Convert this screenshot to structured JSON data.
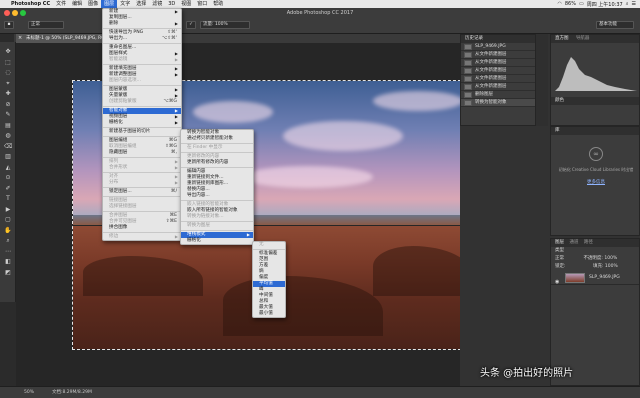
{
  "menubar": {
    "apple": "",
    "items": [
      "Photoshop CC",
      "文件",
      "编辑",
      "图像",
      "图层",
      "文字",
      "选择",
      "滤镜",
      "3D",
      "视图",
      "窗口",
      "帮助"
    ],
    "active_index": 4,
    "battery": "86%",
    "right_text": "周四 上午10:37"
  },
  "window": {
    "title": "Adobe Photoshop CC 2017"
  },
  "optbar": {
    "mode_label": "正常",
    "opacity_label": "不透明度: 100%",
    "flow_label": "流量: 100%",
    "right_label": "基本功能"
  },
  "doc": {
    "tab_title": "未标题-1 @ 50% (SLP_9469.JPG, RGB/8) *"
  },
  "status": {
    "zoom": "50%",
    "docinfo": "文档:8.29M/8.29M"
  },
  "layer_menu": {
    "items": [
      {
        "label": "新建",
        "arrow": true
      },
      {
        "label": "复制图层..."
      },
      {
        "label": "删除",
        "arrow": true
      },
      {
        "sep": true
      },
      {
        "label": "快速导出为 PNG",
        "shortcut": "⇧⌘'"
      },
      {
        "label": "导出为...",
        "shortcut": "⌥⇧⌘'"
      },
      {
        "sep": true
      },
      {
        "label": "重命名图层..."
      },
      {
        "label": "图层样式",
        "arrow": true
      },
      {
        "label": "智能滤镜",
        "dis": true,
        "arrow": true
      },
      {
        "sep": true
      },
      {
        "label": "新建填充图层",
        "arrow": true
      },
      {
        "label": "新建调整图层",
        "arrow": true
      },
      {
        "label": "图层内容选项...",
        "dis": true
      },
      {
        "sep": true
      },
      {
        "label": "图层蒙版",
        "arrow": true
      },
      {
        "label": "矢量蒙版",
        "arrow": true
      },
      {
        "label": "创建剪贴蒙版",
        "shortcut": "⌥⌘G",
        "dis": true
      },
      {
        "sep": true
      },
      {
        "label": "智能对象",
        "arrow": true,
        "hl": true
      },
      {
        "label": "视频图层",
        "arrow": true
      },
      {
        "label": "栅格化",
        "arrow": true
      },
      {
        "sep": true
      },
      {
        "label": "新建基于图层的切片"
      },
      {
        "sep": true
      },
      {
        "label": "图层编组",
        "shortcut": "⌘G"
      },
      {
        "label": "取消图层编组",
        "shortcut": "⇧⌘G",
        "dis": true
      },
      {
        "label": "隐藏图层",
        "shortcut": "⌘,"
      },
      {
        "sep": true
      },
      {
        "label": "排列",
        "arrow": true,
        "dis": true
      },
      {
        "label": "合并形状",
        "arrow": true,
        "dis": true
      },
      {
        "sep": true
      },
      {
        "label": "对齐",
        "arrow": true,
        "dis": true
      },
      {
        "label": "分布",
        "arrow": true,
        "dis": true
      },
      {
        "sep": true
      },
      {
        "label": "锁定图层...",
        "shortcut": "⌘/"
      },
      {
        "sep": true
      },
      {
        "label": "链接图层",
        "dis": true
      },
      {
        "label": "选择链接图层",
        "dis": true
      },
      {
        "sep": true
      },
      {
        "label": "合并图层",
        "shortcut": "⌘E",
        "dis": true
      },
      {
        "label": "合并可见图层",
        "shortcut": "⇧⌘E",
        "dis": true
      },
      {
        "label": "拼合图像"
      },
      {
        "sep": true
      },
      {
        "label": "修边",
        "arrow": true,
        "dis": true
      }
    ]
  },
  "smart_menu": {
    "items": [
      {
        "label": "转换为智能对象"
      },
      {
        "label": "通过拷贝新建智能对象"
      },
      {
        "sep": true
      },
      {
        "label": "在 Finder 中显示",
        "dis": true
      },
      {
        "sep": true
      },
      {
        "label": "更新修改的内容",
        "dis": true
      },
      {
        "label": "更新所有修改的内容"
      },
      {
        "sep": true
      },
      {
        "label": "编辑内容"
      },
      {
        "label": "重新链接到文件..."
      },
      {
        "label": "重新链接到库图形..."
      },
      {
        "label": "替换内容..."
      },
      {
        "label": "导出内容..."
      },
      {
        "sep": true
      },
      {
        "label": "嵌入链接的智能对象",
        "dis": true
      },
      {
        "label": "嵌入所有链接的智能对象"
      },
      {
        "label": "转换为链接对象...",
        "dis": true
      },
      {
        "sep": true
      },
      {
        "label": "转换为图层",
        "dis": true
      },
      {
        "sep": true
      },
      {
        "label": "堆栈模式",
        "arrow": true,
        "hl": true
      },
      {
        "label": "栅格化"
      }
    ]
  },
  "stack_menu": {
    "items": [
      {
        "label": "无",
        "dis": true
      },
      {
        "sep": true
      },
      {
        "label": "标准偏差"
      },
      {
        "label": "范围"
      },
      {
        "label": "方差"
      },
      {
        "label": "熵"
      },
      {
        "label": "偏度"
      },
      {
        "label": "平均值",
        "hl": true
      },
      {
        "label": "峰"
      },
      {
        "label": "中间值"
      },
      {
        "label": "总和"
      },
      {
        "label": "最大值"
      },
      {
        "label": "最小值"
      }
    ]
  },
  "history": {
    "tab": "历史记录",
    "snapshot": "SLP_9469.JPG",
    "rows": [
      "从文件新建图层",
      "从文件新建图层",
      "从文件新建图层",
      "从文件新建图层",
      "从文件新建图层",
      "删除图层",
      "转换为智能对象"
    ],
    "selected_index": 6
  },
  "histogram": {
    "tabs": [
      "直方图",
      "导航器"
    ],
    "footer_label": "颜色"
  },
  "libraries": {
    "tab": "库",
    "msg": "初始化 Creative Cloud Libraries 时出错",
    "link": "更多信息"
  },
  "layers": {
    "tabs": [
      "图层",
      "通道",
      "路径"
    ],
    "kind_label": "类型",
    "mode": "正常",
    "opacity": "不透明度: 100%",
    "lock": "锁定:",
    "fill": "填充: 100%",
    "layer_name": "SLP_9469.JPG"
  },
  "watermark": "头条 @拍出好的照片"
}
